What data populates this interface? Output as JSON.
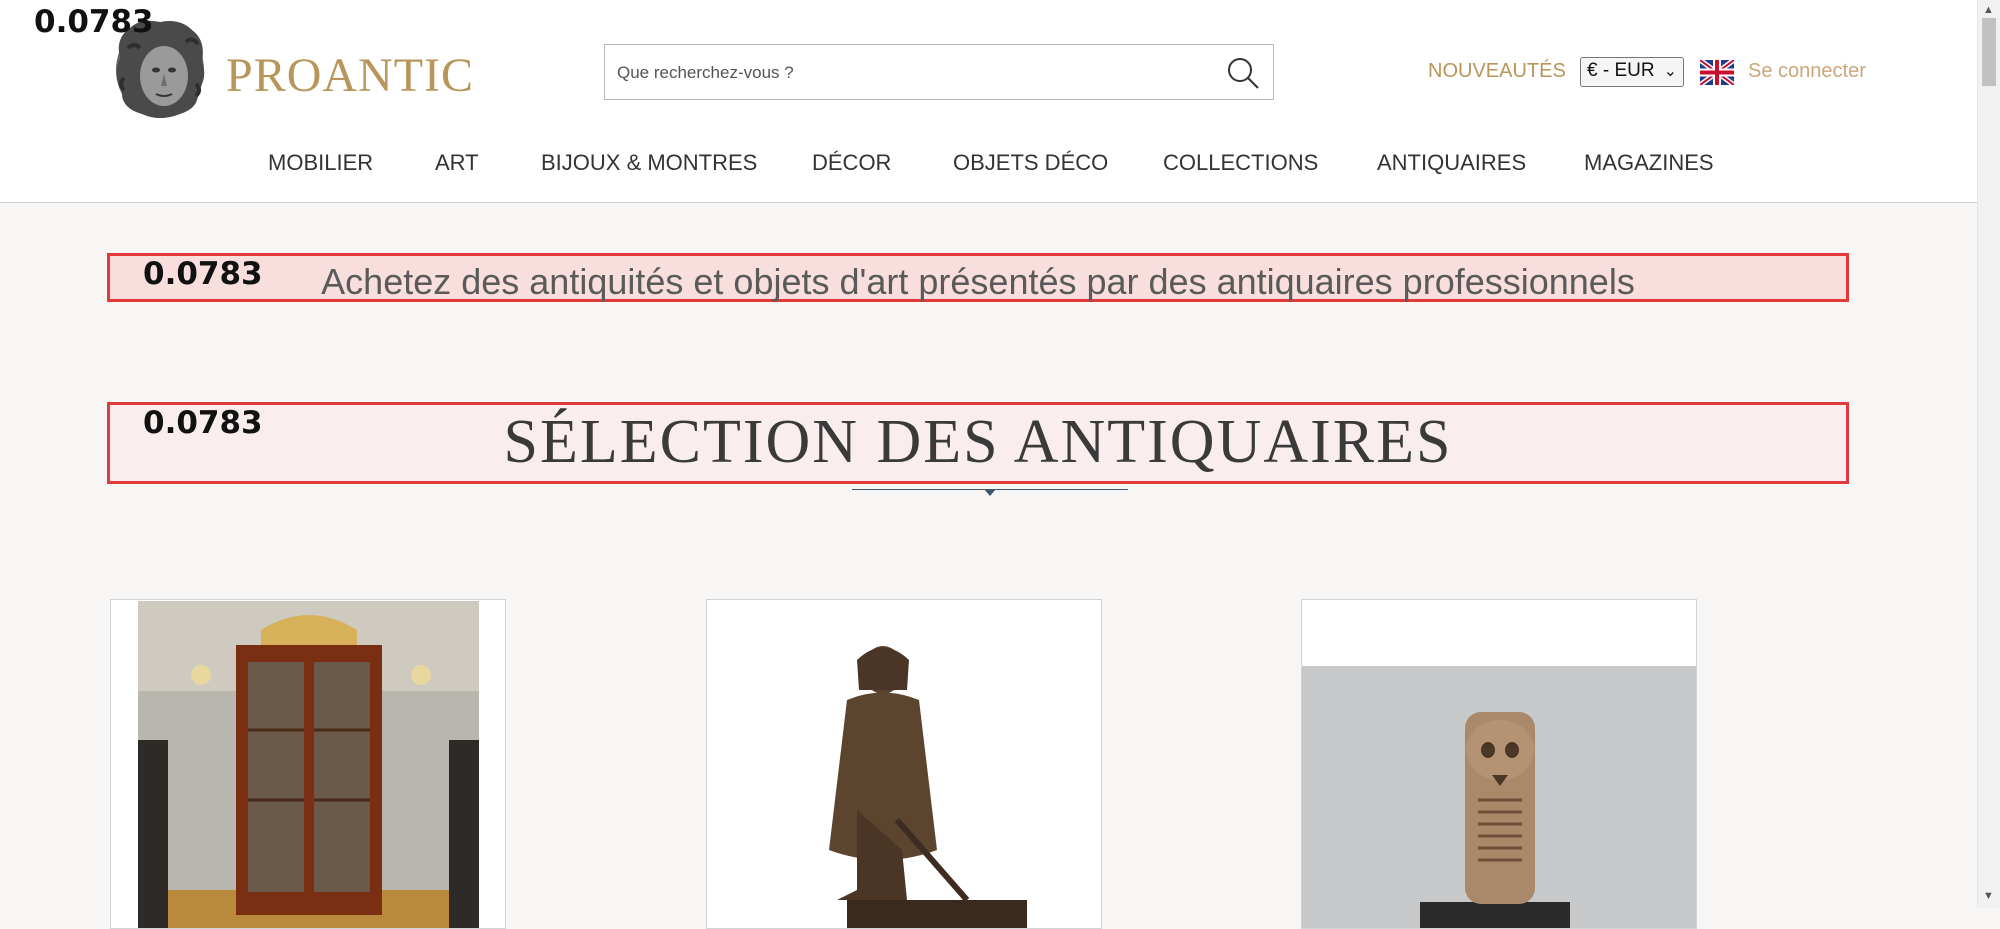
{
  "brand": {
    "name": "PROANTIC",
    "color": "#b8955a"
  },
  "search": {
    "placeholder": "Que recherchez-vous ?"
  },
  "header": {
    "nouveautes": "NOUVEAUTÉS",
    "currency": "€ - EUR",
    "language_icon": "uk-flag-icon",
    "login": "Se connecter"
  },
  "nav": [
    "MOBILIER",
    "ART",
    "BIJOUX & MONTRES",
    "DÉCOR",
    "OBJETS DÉCO",
    "COLLECTIONS",
    "ANTIQUAIRES",
    "MAGAZINES"
  ],
  "overlay": {
    "value": "0.0783"
  },
  "tagline": "Achetez des antiquités et objets d'art présentés par des antiquaires professionnels",
  "section_title": "SÉLECTION DES ANTIQUAIRES",
  "cards": [
    {
      "icon": "bookcase-photo"
    },
    {
      "icon": "bronze-statue-photo"
    },
    {
      "icon": "carved-skull-photo"
    }
  ]
}
